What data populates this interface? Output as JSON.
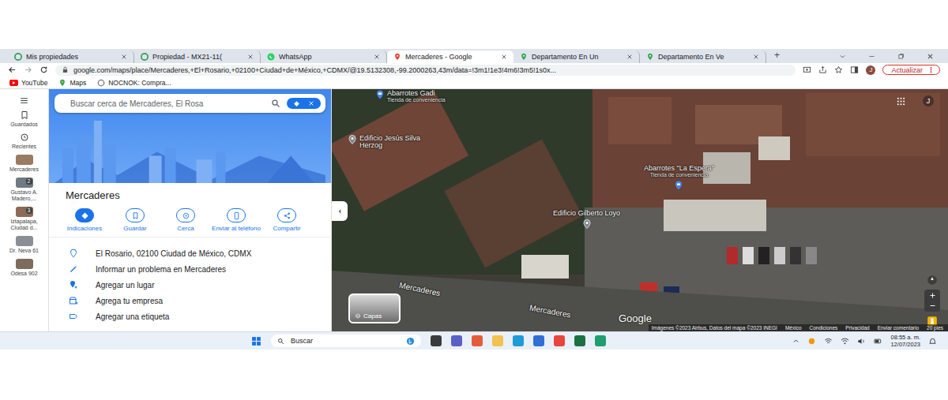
{
  "browser": {
    "tabs": [
      {
        "label": "Mis propiedades",
        "selected": false
      },
      {
        "label": "Propiedad - MX21-11(",
        "selected": false
      },
      {
        "label": "WhatsApp",
        "selected": false
      },
      {
        "label": "Mercaderes - Google",
        "selected": true
      },
      {
        "label": "Departamento En Un",
        "selected": false
      },
      {
        "label": "Departamento En Ve",
        "selected": false
      }
    ],
    "new_tab": "+",
    "url": "google.com/maps/place/Mercaderes,+El+Rosario,+02100+Ciudad+de+México,+CDMX/@19.5132308,-99.2000263,43m/data=!3m1!1e3!4m6!3m5!1s0x...",
    "profile": "J",
    "update_button": "Actualizar",
    "bookmarks": [
      "YouTube",
      "Maps",
      "NOCNOK: Compra..."
    ]
  },
  "rail": [
    {
      "label": "Guardados",
      "kind": "icon"
    },
    {
      "label": "Recientes",
      "kind": "icon"
    },
    {
      "label": "Mercaderes",
      "kind": "thumb"
    },
    {
      "label": "Gustavo A. Madero,...",
      "kind": "thumb",
      "badge": "2"
    },
    {
      "label": "Iztapalapa, Ciudad d...",
      "kind": "thumb",
      "badge": "3"
    },
    {
      "label": "Dr. Neva 61",
      "kind": "thumb"
    },
    {
      "label": "Odesa 902",
      "kind": "thumb"
    }
  ],
  "panel": {
    "search": {
      "placeholder": "Buscar cerca de Mercaderes, El Rosa"
    },
    "title": "Mercaderes",
    "actions": [
      {
        "label": "Indicaciones",
        "selected": true
      },
      {
        "label": "Guardar",
        "selected": false
      },
      {
        "label": "Cerca",
        "selected": false
      },
      {
        "label": "Enviar al teléfono",
        "selected": false
      },
      {
        "label": "Compartir",
        "selected": false
      }
    ],
    "info": [
      "El Rosario, 02100 Ciudad de México, CDMX",
      "Informar un problema en Mercaderes",
      "Agregar un lugar",
      "Agrega tu empresa",
      "Agregar una etiqueta"
    ]
  },
  "map": {
    "pins": [
      {
        "name": "Abarrotes Gadi",
        "sub": "Tienda de conveniencia",
        "kind": "store"
      },
      {
        "name": "Edificio Jesús Silva Herzog",
        "kind": "building"
      },
      {
        "name": "Abarrotes \"La Espera\"",
        "sub": "Tienda de conveniencia",
        "kind": "store"
      },
      {
        "name": "Edificio Gilberto Loyo",
        "kind": "building"
      }
    ],
    "streets": [
      "Mercaderes",
      "Mercaderes"
    ],
    "layers_button": "Capas",
    "logo": "Google",
    "profile": "J",
    "attribution": [
      "Imágenes ©2023 Airbus, Datos del mapa ©2023 INEGI",
      "México",
      "Condiciones",
      "Privacidad",
      "Enviar comentario",
      "20 pies"
    ]
  },
  "taskbar": {
    "search": "Buscar",
    "time": "08:55 a. m.",
    "date": "12/07/2023"
  }
}
